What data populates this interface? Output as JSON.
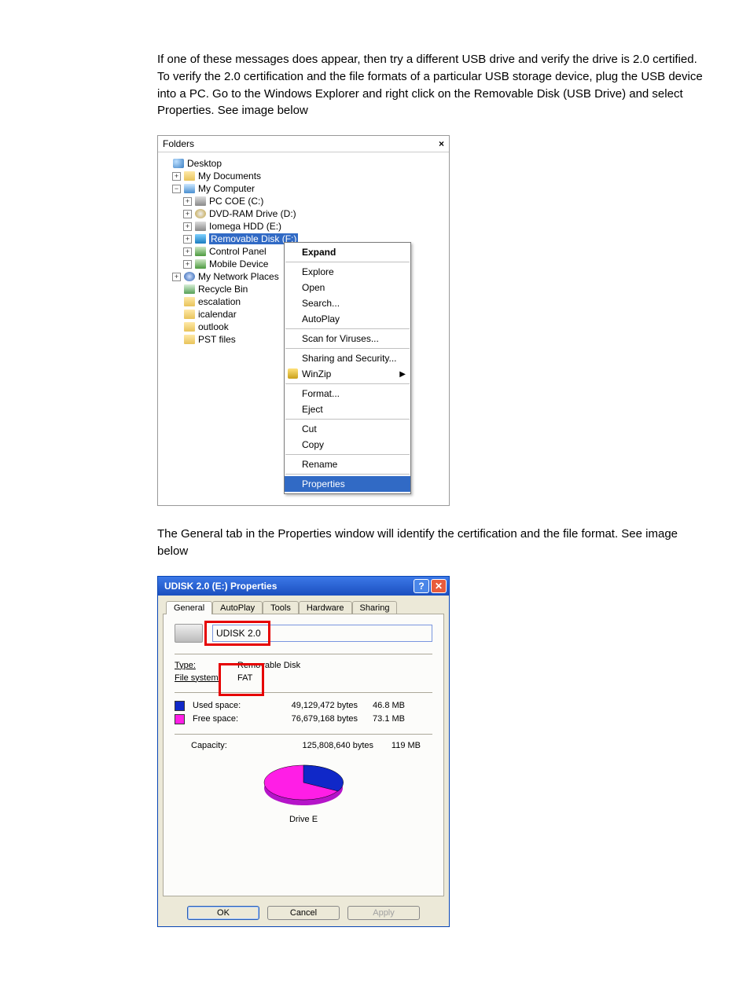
{
  "paragraph1": "If one of these messages does appear, then try a different USB drive and verify the drive is 2.0 certified.  To verify the 2.0 certification and the file formats of a particular USB storage device, plug the USB device into a PC.  Go to the Windows Explorer and right click on the Removable Disk (USB Drive) and select Properties. See image below",
  "paragraph2": "The General tab in the Properties window will identify the certification and the file format.  See image below",
  "folders": {
    "title": "Folders",
    "close_glyph": "×",
    "items": [
      {
        "indent": 1,
        "exp": "",
        "icon": "i-desktop",
        "label": "Desktop"
      },
      {
        "indent": 2,
        "exp": "+",
        "icon": "i-folder",
        "label": "My Documents"
      },
      {
        "indent": 2,
        "exp": "−",
        "icon": "i-comp",
        "label": "My Computer"
      },
      {
        "indent": 3,
        "exp": "+",
        "icon": "i-drive",
        "label": "PC COE (C:)"
      },
      {
        "indent": 3,
        "exp": "+",
        "icon": "i-dvd",
        "label": "DVD-RAM Drive (D:)"
      },
      {
        "indent": 3,
        "exp": "+",
        "icon": "i-drive",
        "label": "Iomega HDD (E:)"
      },
      {
        "indent": 3,
        "exp": "+",
        "icon": "i-rem",
        "label": "Removable Disk (F:)",
        "selected": true
      },
      {
        "indent": 3,
        "exp": "+",
        "icon": "i-cp",
        "label": "Control Panel"
      },
      {
        "indent": 3,
        "exp": "+",
        "icon": "i-cp",
        "label": "Mobile Device"
      },
      {
        "indent": 2,
        "exp": "+",
        "icon": "i-net",
        "label": "My Network Places"
      },
      {
        "indent": 2,
        "exp": "",
        "icon": "i-rec",
        "label": "Recycle Bin"
      },
      {
        "indent": 2,
        "exp": "",
        "icon": "i-folder",
        "label": "escalation"
      },
      {
        "indent": 2,
        "exp": "",
        "icon": "i-folder",
        "label": "icalendar"
      },
      {
        "indent": 2,
        "exp": "",
        "icon": "i-folder",
        "label": "outlook"
      },
      {
        "indent": 2,
        "exp": "",
        "icon": "i-folder",
        "label": "PST files"
      }
    ]
  },
  "context_menu": {
    "items": [
      {
        "label": "Expand",
        "bold": true
      },
      {
        "sep": true
      },
      {
        "label": "Explore"
      },
      {
        "label": "Open"
      },
      {
        "label": "Search..."
      },
      {
        "label": "AutoPlay"
      },
      {
        "sep": true
      },
      {
        "label": "Scan for Viruses..."
      },
      {
        "sep": true
      },
      {
        "label": "Sharing and Security..."
      },
      {
        "label": "WinZip",
        "icon": true,
        "submenu": true
      },
      {
        "sep": true
      },
      {
        "label": "Format..."
      },
      {
        "label": "Eject"
      },
      {
        "sep": true
      },
      {
        "label": "Cut"
      },
      {
        "label": "Copy"
      },
      {
        "sep": true
      },
      {
        "label": "Rename"
      },
      {
        "sep": true
      },
      {
        "label": "Properties",
        "selected": true
      }
    ]
  },
  "properties": {
    "title": "UDISK 2.0 (E:) Properties",
    "tabs": [
      "General",
      "AutoPlay",
      "Tools",
      "Hardware",
      "Sharing"
    ],
    "active_tab": "General",
    "volume_name": "UDISK 2.0",
    "type_label": "Type:",
    "type_value": "Removable Disk",
    "fs_label": "File system:",
    "fs_value": "FAT",
    "used_label": "Used space:",
    "used_bytes": "49,129,472 bytes",
    "used_mb": "46.8 MB",
    "free_label": "Free space:",
    "free_bytes": "76,679,168 bytes",
    "free_mb": "73.1 MB",
    "cap_label": "Capacity:",
    "cap_bytes": "125,808,640 bytes",
    "cap_mb": "119 MB",
    "drive_letter": "Drive E",
    "ok": "OK",
    "cancel": "Cancel",
    "apply": "Apply"
  },
  "chart_data": {
    "type": "pie",
    "title": "Drive E",
    "series": [
      {
        "name": "Used space",
        "value": 49129472,
        "display": "46.8 MB",
        "color": "#1028c8"
      },
      {
        "name": "Free space",
        "value": 76679168,
        "display": "73.1 MB",
        "color": "#ff1ee6"
      }
    ],
    "total": {
      "value": 125808640,
      "display": "119 MB"
    }
  }
}
